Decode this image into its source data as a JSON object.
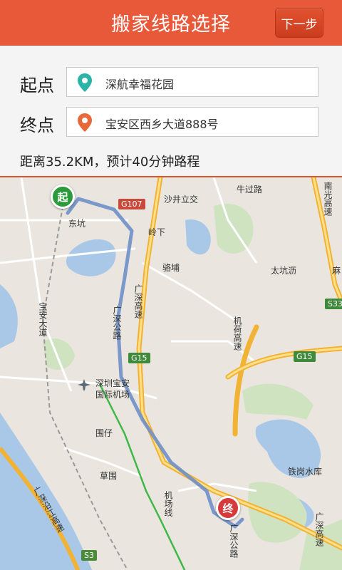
{
  "header": {
    "title": "搬家线路选择",
    "next_label": "下一步"
  },
  "form": {
    "start": {
      "label": "起点",
      "value": "深航幸福花园",
      "icon": "location-pin-teal",
      "color": "#2ab4a8"
    },
    "end": {
      "label": "终点",
      "value": "宝安区西乡大道888号",
      "icon": "location-pin-orange",
      "color": "#e8683a"
    },
    "summary": "距离35.2KM，预计40分钟路程"
  },
  "map": {
    "labels": {
      "shajing": "沙井立交",
      "niuguo": "牛过路",
      "g107": "G107",
      "lingxia": "岭下",
      "dongkeng": "东坑",
      "luopu": "骆埔",
      "taikengli": "太坑沥",
      "ma": "麻",
      "guangshen_hw": "广深高速",
      "guangshen_rd": "广深公路",
      "g15_a": "G15",
      "g15_b": "G15",
      "jihe": "机荷高速",
      "airport_line1": "深圳宝安",
      "airport_line2": "国际机场",
      "weizai": "围仔",
      "caowei": "草围",
      "tiegang": "铁岗水库",
      "yanjiang": "广深沿江高速",
      "s3": "S3",
      "s33": "S33",
      "jiangshi": "南光高速",
      "nanbei": "宝安大道",
      "guangshen_hw2": "广深高速",
      "guangshen_rd2": "广深公路",
      "airport_rail": "机场线"
    },
    "markers": {
      "start": "起",
      "end": "终"
    }
  }
}
